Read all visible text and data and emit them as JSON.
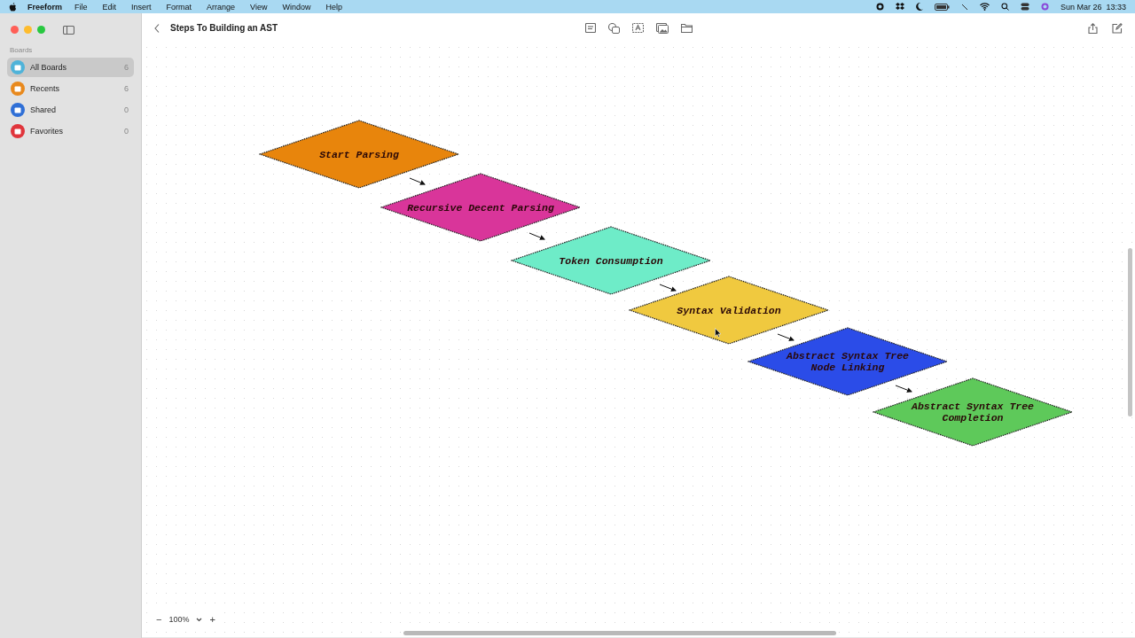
{
  "menu_bar": {
    "app": "Freeform",
    "menus": [
      "File",
      "Edit",
      "Insert",
      "Format",
      "Arrange",
      "View",
      "Window",
      "Help"
    ],
    "clock": "Sun Mar 26  13:33"
  },
  "sidebar": {
    "heading": "Boards",
    "items": [
      {
        "label": "All Boards",
        "count": "6",
        "selected": true,
        "color": "#4fb3d9"
      },
      {
        "label": "Recents",
        "count": "6",
        "selected": false,
        "color": "#e8891d"
      },
      {
        "label": "Shared",
        "count": "0",
        "selected": false,
        "color": "#2f6fd6"
      },
      {
        "label": "Favorites",
        "count": "0",
        "selected": false,
        "color": "#e0353c"
      }
    ]
  },
  "board": {
    "title": "Steps To Building an AST",
    "nodes": [
      {
        "label": "Start Parsing",
        "color": "#e8850c"
      },
      {
        "label": "Recursive Decent Parsing",
        "color": "#d9359a"
      },
      {
        "label": "Token Consumption",
        "color": "#6eecc8"
      },
      {
        "label": "Syntax Validation",
        "color": "#f0c93f"
      },
      {
        "label": "Abstract Syntax Tree\nNode Linking",
        "color": "#2b4ce8"
      },
      {
        "label": "Abstract Syntax Tree\nCompletion",
        "color": "#5ec95a"
      }
    ]
  },
  "zoom": {
    "value": "100%",
    "minus": "−",
    "plus": "+"
  }
}
